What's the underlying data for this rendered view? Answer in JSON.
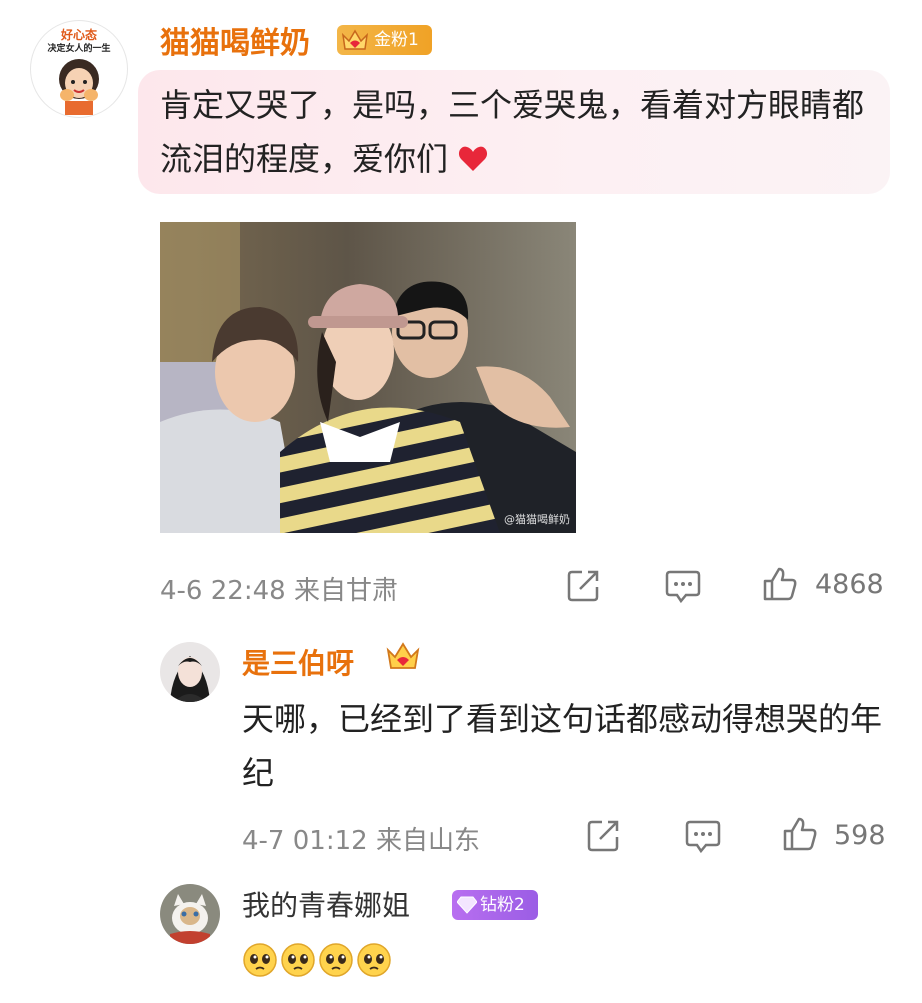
{
  "main_comment": {
    "avatar_text_top": "好心态",
    "avatar_text_sub": "决定女人的一生",
    "username": "猫猫喝鲜奶",
    "badge": "金粉1",
    "text": "肯定又哭了，是吗，三个爱哭鬼，看着对方眼睛都流泪的程度，爱你们",
    "photo_watermark": "@猫猫喝鲜奶",
    "time": "4-6 22:48",
    "location": "来自甘肃",
    "likes": "4868"
  },
  "replies": [
    {
      "username": "是三伯呀",
      "text": "天哪，已经到了看到这句话都感动得想哭的年纪",
      "time": "4-7 01:12",
      "location": "来自山东",
      "likes": "598"
    },
    {
      "username": "我的青春娜姐",
      "badge": "钻粉2",
      "emoji_count": 4
    }
  ],
  "colors": {
    "username": "#e8710c",
    "gold_badge": "#f0a226",
    "diamond_badge": "#9b5de5",
    "meta": "#888888",
    "bubble": "#fde7ec",
    "heart": "#e8273a"
  },
  "icons": [
    "share-icon",
    "comment-icon",
    "like-icon",
    "crown-icon",
    "diamond-icon",
    "heart-icon",
    "pleading-emoji"
  ]
}
